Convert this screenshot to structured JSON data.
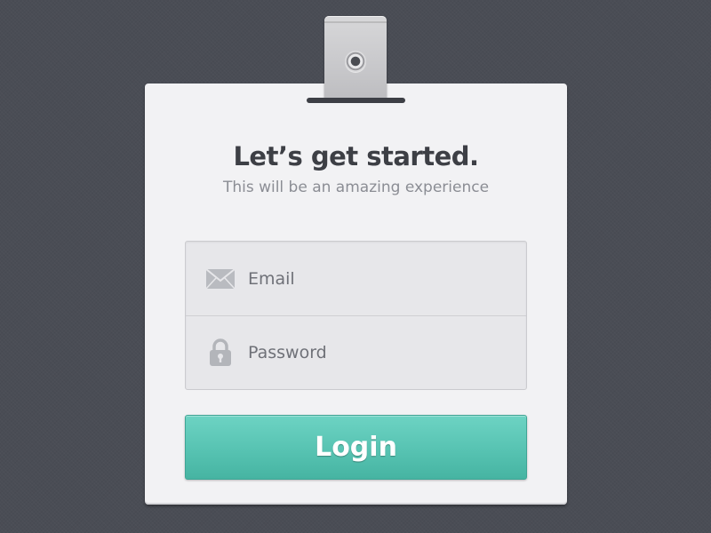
{
  "page": {
    "title": "Let’s get started.",
    "subtitle": "This will be an amazing experience"
  },
  "form": {
    "email": {
      "placeholder": "Email",
      "value": "",
      "icon": "envelope-icon"
    },
    "password": {
      "placeholder": "Password",
      "value": "",
      "icon": "lock-icon"
    },
    "login_label": "Login"
  },
  "colors": {
    "background": "#4a4d55",
    "card": "#f2f2f4",
    "accent": "#57c3b2",
    "title_text": "#3d3f45",
    "subtitle_text": "#8b8d94"
  }
}
